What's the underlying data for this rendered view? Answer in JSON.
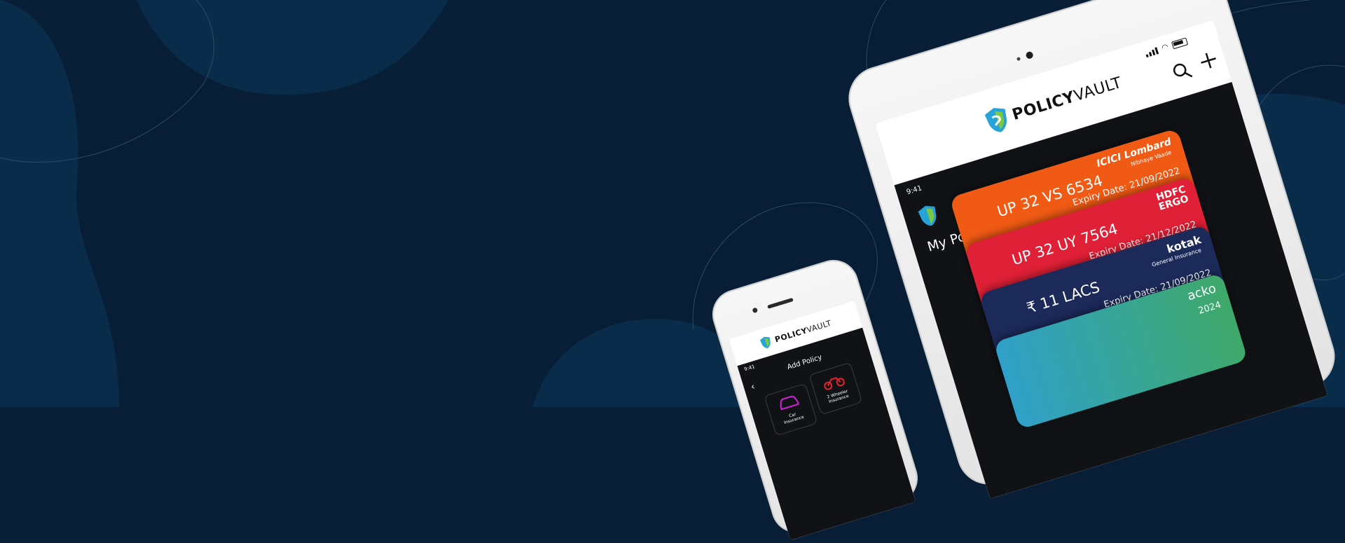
{
  "colors": {
    "background": "#081e36",
    "blob": "#0a2c4b",
    "card_icici": "#f05a14",
    "card_hdfc": "#e02036",
    "card_kotak": "#1c2a5a",
    "card_acko": "#3fa96a",
    "logo_green": "#7ac943",
    "logo_blue": "#28a3d8"
  },
  "tablet": {
    "brand_bold": "POLICY",
    "brand_light": "VAULT",
    "time": "9:41",
    "title": "My Policies (9)",
    "icons": [
      "search-icon",
      "add-icon",
      "signal-icon",
      "wifi-icon",
      "battery-icon",
      "shield-logo-icon"
    ],
    "cards": [
      {
        "reg": "UP 32 VS 6534",
        "expiry": "Expiry Date: 21/09/2022",
        "insurer": "ICICI Lombard",
        "insurer_tag": "Nibhaye Vaade",
        "vehicle": "motorcycle-icon"
      },
      {
        "reg": "UP 32 UY 7564",
        "expiry": "Expiry Date: 21/12/2022",
        "insurer": "HDFC ERGO",
        "vehicle": "car-icon"
      },
      {
        "reg": "₹ 11 LACS",
        "expiry": "Expiry Date: 21/09/2022",
        "insurer": "kotak",
        "insurer_tag": "General Insurance",
        "vehicle": "health-icon"
      },
      {
        "reg": "",
        "expiry": "2024",
        "insurer": "acko",
        "vehicle": ""
      }
    ]
  },
  "phone": {
    "brand_bold": "POLICY",
    "brand_light": "VAULT",
    "time": "9:41",
    "title": "Add Policy",
    "options": [
      {
        "label": "Car Insurance",
        "icon": "car-icon"
      },
      {
        "label": "2 Wheeler Insurance",
        "icon": "motorcycle-icon"
      }
    ]
  }
}
